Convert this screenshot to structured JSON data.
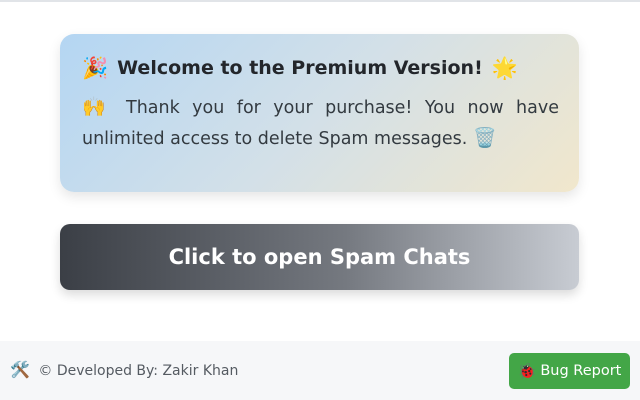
{
  "welcome": {
    "title_icon": "🎉",
    "title": "Welcome to the Premium Version!",
    "title_trailing_icon": "🌟",
    "message_icon": "🙌",
    "message": "Thank you for your purchase! You now have unlimited access to delete Spam messages.",
    "message_trailing_icon": "🗑️",
    "gradient_colors": [
      "#b4d6f3",
      "#d3e0e8",
      "#f1e7cc"
    ]
  },
  "main_button": {
    "label": "Click to open Spam Chats",
    "gradient_colors": [
      "#3b3f46",
      "#757980",
      "#c8ccd3"
    ]
  },
  "footer": {
    "credit_icon": "🛠️",
    "credit_text": "© Developed By: Zakir Khan",
    "bug_report_icon": "🐞",
    "bug_report_label": "Bug Report",
    "bug_report_color": "#43a647"
  }
}
